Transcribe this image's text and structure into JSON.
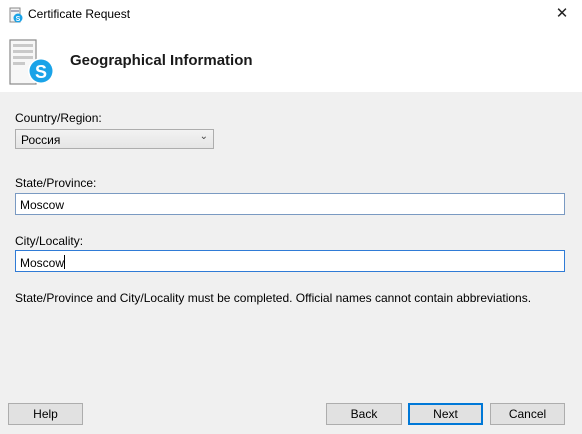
{
  "window": {
    "title": "Certificate Request",
    "close_glyph": "✕"
  },
  "header": {
    "heading": "Geographical Information",
    "icon": "skype-certificate-icon",
    "icon_badge_letter": "S",
    "accent_color": "#1aa3e8"
  },
  "form": {
    "country": {
      "label": "Country/Region:",
      "value": "Россия"
    },
    "state": {
      "label": "State/Province:",
      "value": "Moscow"
    },
    "city": {
      "label": "City/Locality:",
      "value": "Moscow"
    },
    "hint": "State/Province and City/Locality must be completed. Official names cannot contain abbreviations."
  },
  "buttons": {
    "help": "Help",
    "back": "Back",
    "next": "Next",
    "cancel": "Cancel"
  }
}
